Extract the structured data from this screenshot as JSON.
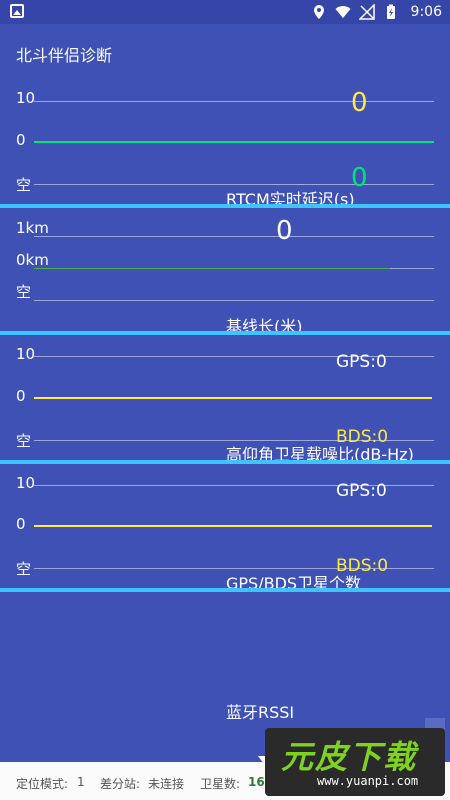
{
  "status_bar": {
    "time": "9:06"
  },
  "app_title": "北斗伴侣诊断",
  "panels": [
    {
      "labels": [
        "10",
        "0",
        "空"
      ],
      "value_top": "0",
      "value_bottom": "0",
      "caption": "RTCM实时延迟(s)"
    },
    {
      "labels": [
        "1km",
        "0km",
        "空"
      ],
      "value_top": "0",
      "caption": "基线长(米)"
    },
    {
      "labels": [
        "10",
        "0",
        "空"
      ],
      "gps": "GPS:0",
      "bds": "BDS:0",
      "caption": "高仰角卫星载噪比(dB-Hz)"
    },
    {
      "labels": [
        "10",
        "0",
        "空"
      ],
      "gps": "GPS:0",
      "bds": "BDS:0",
      "caption": "GPS/BDS卫星个数"
    }
  ],
  "bottom_caption": "蓝牙RSSI",
  "footer": {
    "mode_label": "定位模式:",
    "mode_value": "1",
    "station_label": "差分站:",
    "station_value": "未连接",
    "sats_label": "卫星数:",
    "sats_value": "16"
  },
  "watermark": {
    "main": "元皮下载",
    "url": "www.yuanpi.com"
  },
  "colors": {
    "background": "#3f51b5",
    "separator": "#40c4ff",
    "green": "#00e676",
    "yellow": "#ffeb3b"
  }
}
